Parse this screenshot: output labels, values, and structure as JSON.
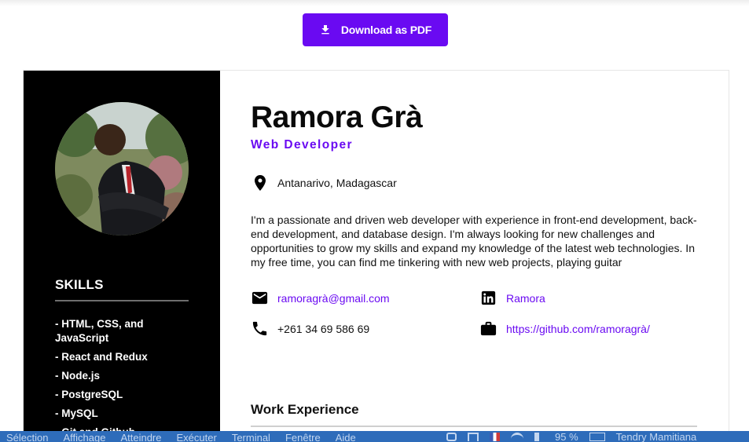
{
  "download_button": {
    "label": "Download as PDF",
    "icon": "download-icon"
  },
  "profile": {
    "name": "Ramora Grà",
    "role": "Web Developer",
    "location": "Antanarivo, Madagascar",
    "bio": "I'm a passionate and driven web developer with experience in front-end development, back-end development, and database design. I'm always looking for new challenges and opportunities to grow my skills and expand my knowledge of the latest web technologies. In my free time, you can find me tinkering with new web projects, playing guitar"
  },
  "contacts": {
    "email": "ramoragrà@gmail.com",
    "phone": "+261 34 69 586 69",
    "linkedin": "Ramora",
    "github": "https://github.com/ramoragrà/"
  },
  "skills": {
    "title": "SKILLS",
    "items": [
      "- HTML, CSS, and JavaScript",
      "- React and Redux",
      "- Node.js",
      "- PostgreSQL",
      "- MySQL",
      "- Git and Github"
    ]
  },
  "sections": {
    "work_title": "Work Experience"
  },
  "menubar": {
    "items": [
      "Sélection",
      "Affichage",
      "Atteindre",
      "Exécuter",
      "Terminal",
      "Fenêtre",
      "Aide"
    ],
    "battery": "95 %",
    "user": "Tendry Mamitiana"
  },
  "colors": {
    "accent": "#6a0af2",
    "sidebar": "#000000",
    "menubar": "#2e6cba"
  }
}
